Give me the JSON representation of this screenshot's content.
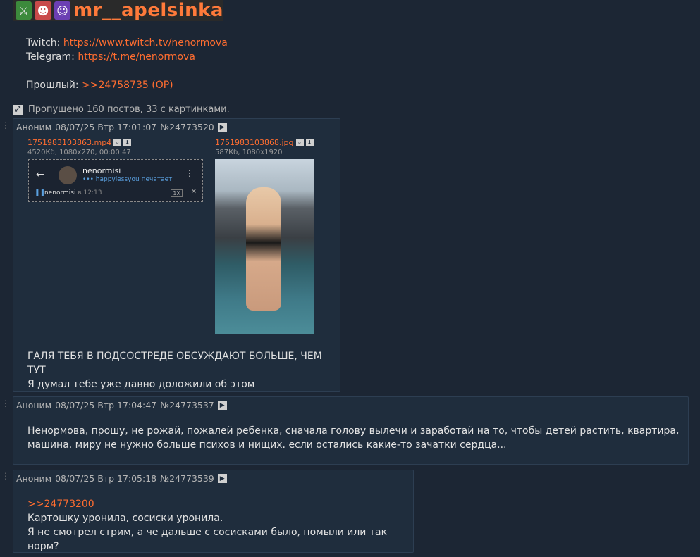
{
  "banner": {
    "emotes": [
      "sword-emote",
      "clown-emote",
      "purple-emote"
    ],
    "name": "mr__apelsinka"
  },
  "op": {
    "twitch_label": "Twitch:",
    "twitch_url": "https://www.twitch.tv/nenormova",
    "telegram_label": "Telegram:",
    "telegram_url": "https://t.me/nenormova",
    "prev_label": "Прошлый:",
    "prev_link": ">>24758735 (OP)"
  },
  "skipped_text": "Пропущено 160 постов, 33 с картинками.",
  "posts": [
    {
      "author": "Аноним",
      "date": "08/07/25 Втр 17:01:07",
      "number": "№24773520",
      "files": [
        {
          "name": "1751983103863.mp4",
          "meta": "4520Кб, 1080x270, 00:00:47",
          "video": {
            "chat_name": "nenormisi",
            "typing": "••• happylessyou печатает",
            "bottom_name": "nenormisi",
            "bottom_time": "в 12:13",
            "speed": "1X"
          }
        },
        {
          "name": "1751983103868.jpg",
          "meta": "587Кб, 1080x1920"
        }
      ],
      "lines": [
        "ГАЛЯ ТЕБЯ В ПОДСОСТРЕДЕ ОБСУЖДАЮТ БОЛЬШЕ, ЧЕМ ТУТ",
        "Я думал тебе уже давно доложили об этом"
      ]
    },
    {
      "author": "Аноним",
      "date": "08/07/25 Втр 17:04:47",
      "number": "№24773537",
      "lines": [
        "Ненормова, прошу, не рожай, пожалей ребенка, сначала голову вылечи и заработай на то, чтобы детей растить, квартира,",
        "машина. миру не нужно больше психов и нищих. если остались какие-то зачатки сердца..."
      ]
    },
    {
      "author": "Аноним",
      "date": "08/07/25 Втр 17:05:18",
      "number": "№24773539",
      "reply": ">>24773200",
      "lines": [
        "Картошку уронила, сосиски уронила.",
        "Я не смотрел стрим, а че дальше с сосисками было, помыли или так норм?"
      ]
    }
  ],
  "colors": {
    "background": "#1c2634",
    "post_background": "#1f2d3d",
    "link": "#ff6d30"
  }
}
